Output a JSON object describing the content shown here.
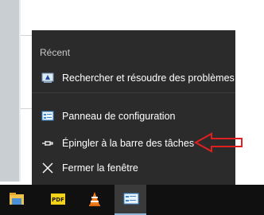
{
  "jumplist": {
    "section_title": "Récent",
    "recent_items": [
      {
        "label": "Rechercher et résoudre des problèmes",
        "icon": "troubleshoot-icon"
      }
    ],
    "tasks": [
      {
        "label": "Panneau de configuration",
        "icon": "control-panel-icon"
      },
      {
        "label": "Épingler à la barre des tâches",
        "icon": "pin-icon"
      },
      {
        "label": "Fermer la fenêtre",
        "icon": "close-icon"
      }
    ]
  },
  "taskbar": {
    "items": [
      {
        "name": "file-explorer",
        "icon": "folder-icon"
      },
      {
        "name": "pdf-app",
        "icon": "pdf-icon",
        "text": "PDF"
      },
      {
        "name": "vlc",
        "icon": "vlc-cone-icon"
      },
      {
        "name": "control-panel",
        "icon": "control-panel-icon",
        "active": true
      }
    ]
  },
  "annotation": {
    "color": "#e02020"
  }
}
